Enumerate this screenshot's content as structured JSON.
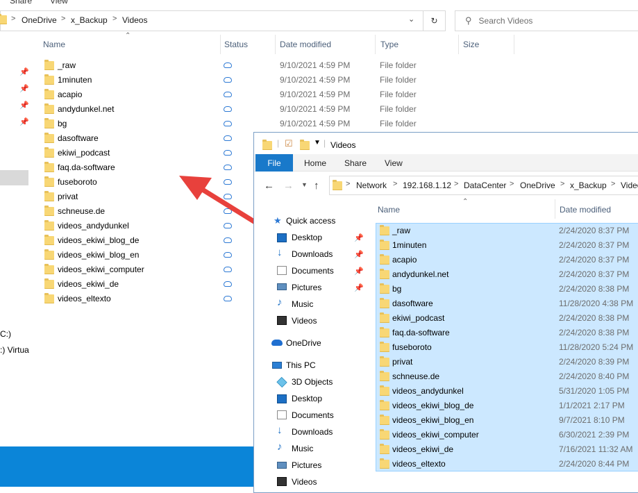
{
  "back_window": {
    "menu_fragments": [
      "Share",
      "View"
    ],
    "breadcrumb": [
      "OneDrive",
      "x_Backup",
      "Videos"
    ],
    "search_placeholder": "Search Videos",
    "columns": {
      "name": "Name",
      "status": "Status",
      "date": "Date modified",
      "type": "Type",
      "size": "Size"
    },
    "rows": [
      {
        "name": "_raw",
        "date": "9/10/2021 4:59 PM",
        "type": "File folder"
      },
      {
        "name": "1minuten",
        "date": "9/10/2021 4:59 PM",
        "type": "File folder"
      },
      {
        "name": "acapio",
        "date": "9/10/2021 4:59 PM",
        "type": "File folder"
      },
      {
        "name": "andydunkel.net",
        "date": "9/10/2021 4:59 PM",
        "type": "File folder"
      },
      {
        "name": "bg",
        "date": "9/10/2021 4:59 PM",
        "type": "File folder"
      },
      {
        "name": "dasoftware",
        "date": "",
        "type": ""
      },
      {
        "name": "ekiwi_podcast",
        "date": "",
        "type": ""
      },
      {
        "name": "faq.da-software",
        "date": "",
        "type": ""
      },
      {
        "name": "fuseboroto",
        "date": "",
        "type": ""
      },
      {
        "name": "privat",
        "date": "",
        "type": ""
      },
      {
        "name": "schneuse.de",
        "date": "",
        "type": ""
      },
      {
        "name": "videos_andydunkel",
        "date": "",
        "type": ""
      },
      {
        "name": "videos_ekiwi_blog_de",
        "date": "",
        "type": ""
      },
      {
        "name": "videos_ekiwi_blog_en",
        "date": "",
        "type": ""
      },
      {
        "name": "videos_ekiwi_computer",
        "date": "",
        "type": ""
      },
      {
        "name": "videos_ekiwi_de",
        "date": "",
        "type": ""
      },
      {
        "name": "videos_eltexto",
        "date": "",
        "type": ""
      }
    ],
    "left_fragments": [
      "C:)",
      ":) Virtua"
    ]
  },
  "front_window": {
    "title": "Videos",
    "ribbon_tabs": {
      "file": "File",
      "home": "Home",
      "share": "Share",
      "view": "View"
    },
    "breadcrumb": [
      "Network",
      "192.168.1.12",
      "DataCenter",
      "OneDrive",
      "x_Backup",
      "Videos"
    ],
    "columns": {
      "name": "Name",
      "date": "Date modified"
    },
    "nav": {
      "quick_access": "Quick access",
      "qa_desktop": "Desktop",
      "qa_downloads": "Downloads",
      "qa_documents": "Documents",
      "qa_pictures": "Pictures",
      "qa_music": "Music",
      "qa_videos": "Videos",
      "onedrive": "OneDrive",
      "this_pc": "This PC",
      "pc_3d": "3D Objects",
      "pc_desktop": "Desktop",
      "pc_documents": "Documents",
      "pc_downloads": "Downloads",
      "pc_music": "Music",
      "pc_pictures": "Pictures",
      "pc_videos": "Videos"
    },
    "rows": [
      {
        "name": "_raw",
        "date": "2/24/2020 8:37 PM"
      },
      {
        "name": "1minuten",
        "date": "2/24/2020 8:37 PM"
      },
      {
        "name": "acapio",
        "date": "2/24/2020 8:37 PM"
      },
      {
        "name": "andydunkel.net",
        "date": "2/24/2020 8:37 PM"
      },
      {
        "name": "bg",
        "date": "2/24/2020 8:38 PM"
      },
      {
        "name": "dasoftware",
        "date": "11/28/2020 4:38 PM"
      },
      {
        "name": "ekiwi_podcast",
        "date": "2/24/2020 8:38 PM"
      },
      {
        "name": "faq.da-software",
        "date": "2/24/2020 8:38 PM"
      },
      {
        "name": "fuseboroto",
        "date": "11/28/2020 5:24 PM"
      },
      {
        "name": "privat",
        "date": "2/24/2020 8:39 PM"
      },
      {
        "name": "schneuse.de",
        "date": "2/24/2020 8:40 PM"
      },
      {
        "name": "videos_andydunkel",
        "date": "5/31/2020 1:05 PM"
      },
      {
        "name": "videos_ekiwi_blog_de",
        "date": "1/1/2021 2:17 PM"
      },
      {
        "name": "videos_ekiwi_blog_en",
        "date": "9/7/2021 8:10 PM"
      },
      {
        "name": "videos_ekiwi_computer",
        "date": "6/30/2021 2:39 PM"
      },
      {
        "name": "videos_ekiwi_de",
        "date": "7/16/2021 11:32 AM"
      },
      {
        "name": "videos_eltexto",
        "date": "2/24/2020 8:44 PM"
      }
    ]
  },
  "colors": {
    "accent": "#1979ca",
    "selection": "#cce8ff",
    "arrow": "#e8413c",
    "taskbar": "#0b85d8"
  }
}
